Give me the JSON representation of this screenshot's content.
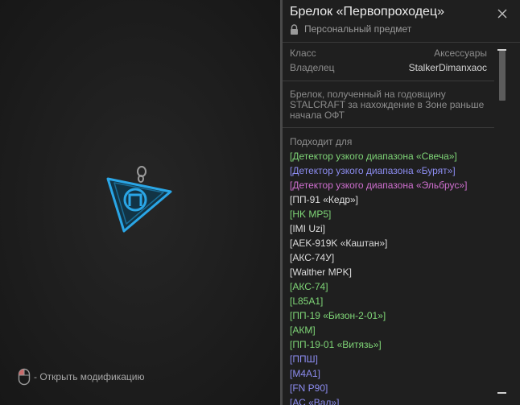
{
  "viewer": {
    "hint_text": "- Открыть модификацию",
    "mouse_icon": "mouse-icon",
    "item_icon": "keychain-icon"
  },
  "panel": {
    "title": "Брелок «Первопроходец»",
    "subtitle": "Персональный предмет",
    "lock_icon": "lock-icon",
    "close_icon": "close-icon",
    "class_label": "Класс",
    "class_value": "Аксессуары",
    "owner_label": "Владелец",
    "owner_value": "StalkerDimanxaoc",
    "description": "Брелок, полученный на годовщину STALCRAFT за нахождение в Зоне раньше начала ОФТ",
    "fits_title": "Подходит для",
    "fits_items": [
      {
        "text": "[Детектор узкого диапазона «Свеча»]",
        "color": "#7fd677"
      },
      {
        "text": "[Детектор узкого диапазона «Бурят»]",
        "color": "#8c8cf0"
      },
      {
        "text": "[Детектор узкого диапазона «Эльбрус»]",
        "color": "#d070d0"
      },
      {
        "text": "[ПП-91 «Кедр»]",
        "color": "#dcdcdc"
      },
      {
        "text": "[HK MP5]",
        "color": "#7fd677"
      },
      {
        "text": "[IMI Uzi]",
        "color": "#dcdcdc"
      },
      {
        "text": "[AEK-919K «Каштан»]",
        "color": "#dcdcdc"
      },
      {
        "text": "[АКС-74У]",
        "color": "#dcdcdc"
      },
      {
        "text": "[Walther MPK]",
        "color": "#dcdcdc"
      },
      {
        "text": "[АКС-74]",
        "color": "#7fd677"
      },
      {
        "text": "[L85A1]",
        "color": "#7fd677"
      },
      {
        "text": "[ПП-19 «Бизон-2-01»]",
        "color": "#7fd677"
      },
      {
        "text": "[АКМ]",
        "color": "#7fd677"
      },
      {
        "text": "[ПП-19-01 «Витязь»]",
        "color": "#7fd677"
      },
      {
        "text": "[ППШ]",
        "color": "#8c8cf0"
      },
      {
        "text": "[M4A1]",
        "color": "#8c8cf0"
      },
      {
        "text": "[FN P90]",
        "color": "#8c8cf0"
      },
      {
        "text": "[АС «Вал»]",
        "color": "#8c8cf0"
      }
    ]
  },
  "colors": {
    "accent_blue": "#2aa6e6",
    "rarity_green": "#7fd677",
    "rarity_blue": "#8c8cf0",
    "rarity_purple": "#d070d0",
    "rarity_white": "#dcdcdc"
  }
}
